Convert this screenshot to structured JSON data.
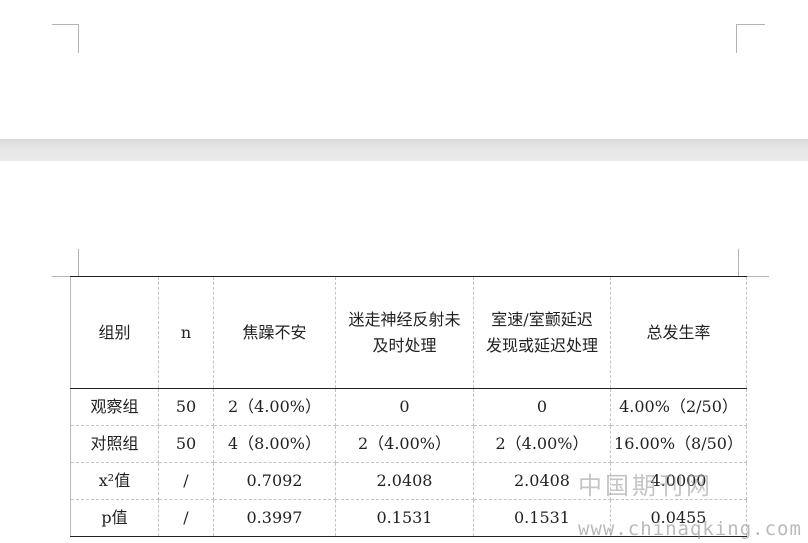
{
  "table": {
    "headers": [
      "组别",
      "n",
      "焦躁不安",
      "迷走神经反射未及时处理",
      "室速/室颤延迟发现或延迟处理",
      "总发生率"
    ],
    "rows": [
      [
        "观察组",
        "50",
        "2（4.00%）",
        "0",
        "0",
        "4.00%（2/50）"
      ],
      [
        "对照组",
        "50",
        "4（8.00%）",
        "2（4.00%）",
        "2（4.00%）",
        "16.00%（8/50）"
      ],
      [
        "x²值",
        "/",
        "0.7092",
        "2.0408",
        "2.0408",
        "4.0000"
      ],
      [
        "p值",
        "/",
        "0.3997",
        "0.1531",
        "0.1531",
        "0.0455"
      ]
    ]
  },
  "watermark": {
    "text": "中国期刊网",
    "url": "www.chinaqking.com"
  }
}
